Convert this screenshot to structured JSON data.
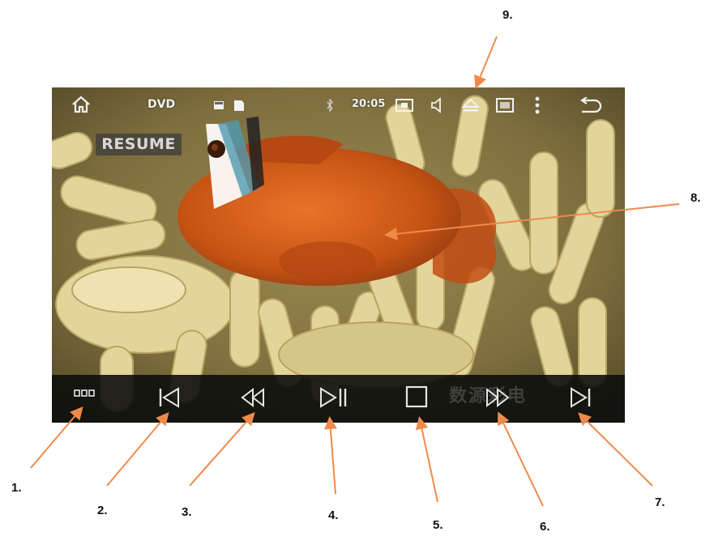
{
  "status_bar": {
    "source_label": "DVD",
    "time": "20:05",
    "icons": [
      "home-icon",
      "sd-card-icon",
      "cast-icon",
      "volume-icon",
      "eject-icon",
      "picture-icon",
      "more-menu-icon",
      "back-arrow-icon"
    ]
  },
  "video": {
    "resume_label": "RESUME",
    "watermark_text": "数源彩电"
  },
  "controls": [
    "menu-dots-icon",
    "previous-icon",
    "rewind-icon",
    "play-pause-icon",
    "stop-icon",
    "fast-forward-icon",
    "next-icon"
  ],
  "annotations": [
    "1.",
    "2.",
    "3.",
    "4.",
    "5.",
    "6.",
    "7.",
    "8.",
    "9."
  ],
  "colors": {
    "arrow": "#f08a4b",
    "control_bar": "#0c0e0c",
    "icon": "#e6e6e6",
    "fish": "#d8621a"
  }
}
